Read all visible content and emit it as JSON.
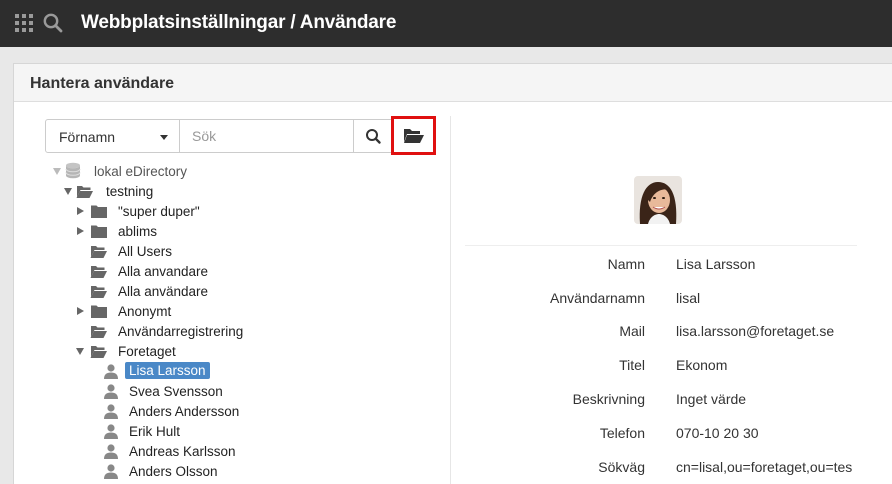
{
  "app": {
    "title": "Webbplatsinställningar / Användare"
  },
  "panel": {
    "title": "Hantera användare"
  },
  "search": {
    "field_selected": "Förnamn",
    "placeholder": "Sök"
  },
  "tree": {
    "root": "lokal eDirectory",
    "items": [
      "testning",
      "\"super duper\"",
      "ablims",
      "All Users",
      "Alla anvandare",
      "Alla användare",
      "Anonymt",
      "Användarregistrering",
      "Foretaget"
    ],
    "users": [
      "Lisa Larsson",
      "Svea Svensson",
      "Anders Andersson",
      "Erik Hult",
      "Andreas Karlsson",
      "Anders Olsson"
    ]
  },
  "details": {
    "fields": [
      {
        "label": "Namn",
        "value": "Lisa Larsson"
      },
      {
        "label": "Användarnamn",
        "value": "lisal"
      },
      {
        "label": "Mail",
        "value": "lisa.larsson@foretaget.se"
      },
      {
        "label": "Titel",
        "value": "Ekonom"
      },
      {
        "label": "Beskrivning",
        "value": "Inget värde"
      },
      {
        "label": "Telefon",
        "value": "070-10 20 30"
      },
      {
        "label": "Sökväg",
        "value": "cn=lisal,ou=foretaget,ou=tes"
      }
    ]
  },
  "colors": {
    "topbar": "#2d2d2d",
    "selection": "#4a88c7",
    "highlight_box": "#e01010"
  }
}
